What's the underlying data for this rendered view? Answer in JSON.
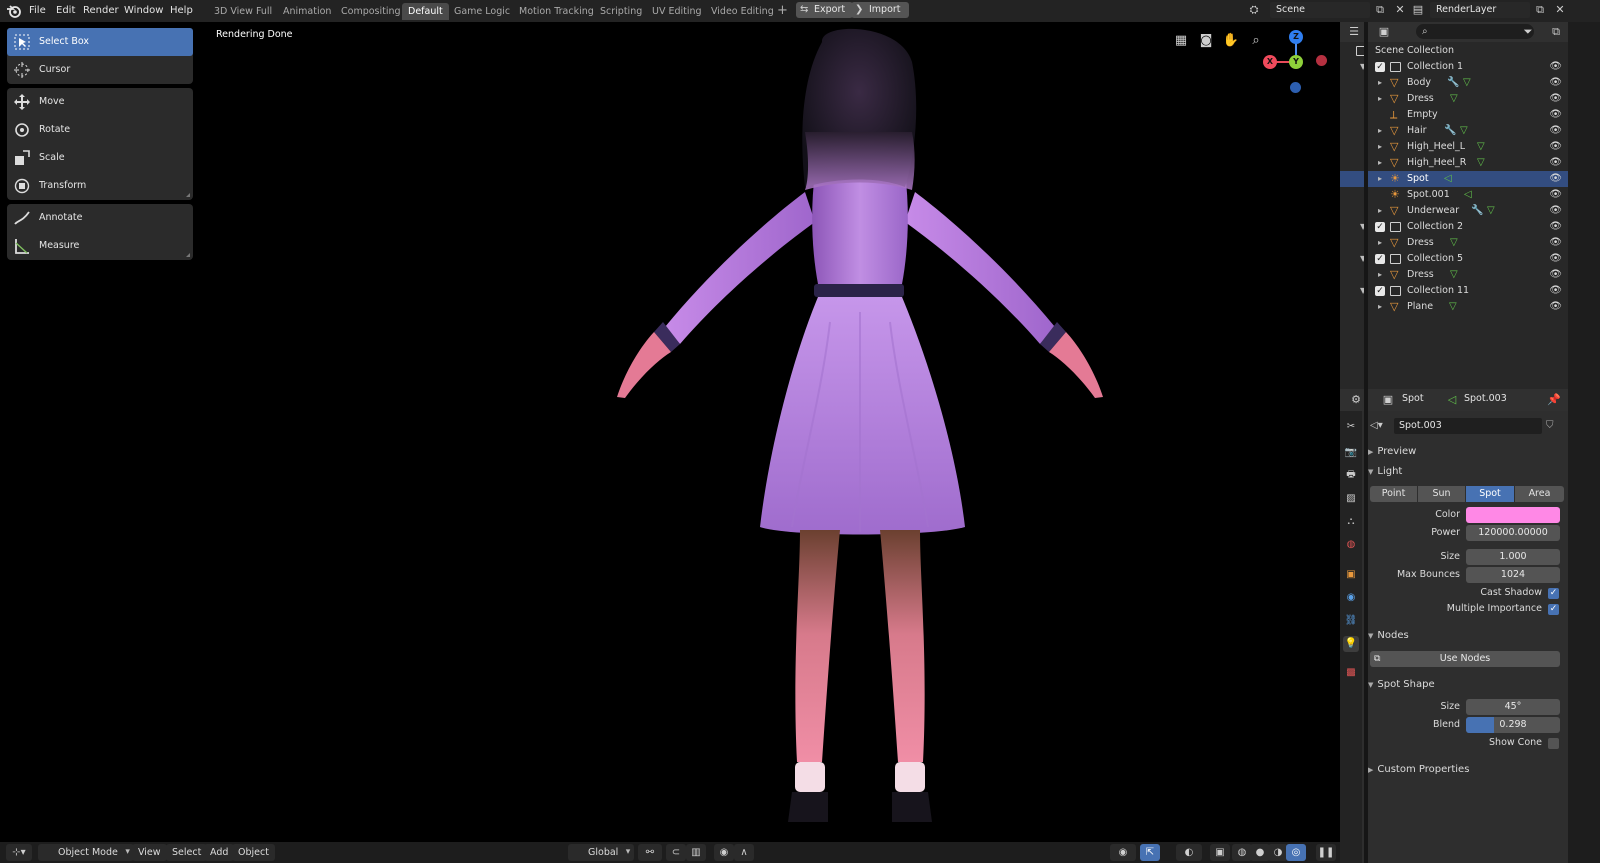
{
  "menu": [
    "File",
    "Edit",
    "Render",
    "Window",
    "Help"
  ],
  "workspaces": [
    "3D View Full",
    "Animation",
    "Compositing",
    "Default",
    "Game Logic",
    "Motion Tracking",
    "Scripting",
    "UV Editing",
    "Video Editing"
  ],
  "active_workspace": "Default",
  "header_buttons": {
    "export": "Export",
    "import": "Import"
  },
  "scene": "Scene",
  "render_layer": "RenderLayer",
  "tools": {
    "select_box": "Select Box",
    "cursor": "Cursor",
    "move": "Move",
    "rotate": "Rotate",
    "scale": "Scale",
    "transform": "Transform",
    "annotate": "Annotate",
    "measure": "Measure"
  },
  "viewport": {
    "status": "Rendering Done",
    "gizmo": {
      "z": "Z",
      "y": "Y",
      "x": "X"
    }
  },
  "bottom_bar": {
    "mode": "Object Mode",
    "view": "View",
    "select": "Select",
    "add": "Add",
    "object": "Object",
    "orientation": "Global"
  },
  "outliner": {
    "root": "Scene Collection",
    "rows": [
      {
        "name": "Collection 1"
      },
      {
        "name": "Body"
      },
      {
        "name": "Dress"
      },
      {
        "name": "Empty"
      },
      {
        "name": "Hair"
      },
      {
        "name": "High_Heel_L"
      },
      {
        "name": "High_Heel_R"
      },
      {
        "name": "Spot"
      },
      {
        "name": "Spot.001"
      },
      {
        "name": "Underwear"
      },
      {
        "name": "Collection 2"
      },
      {
        "name": "Dress"
      },
      {
        "name": "Collection 5"
      },
      {
        "name": "Dress"
      },
      {
        "name": "Collection 11"
      },
      {
        "name": "Plane"
      }
    ]
  },
  "properties": {
    "object": "Spot",
    "data": "Spot.003",
    "datablock": "Spot.003",
    "panels": {
      "preview": "Preview",
      "light": "Light",
      "nodes": "Nodes",
      "spot_shape": "Spot Shape",
      "custom": "Custom Properties"
    },
    "light_types": [
      "Point",
      "Sun",
      "Spot",
      "Area"
    ],
    "active_light_type": "Spot",
    "color_label": "Color",
    "color_value": "#ff88e6",
    "power_label": "Power",
    "power": "120000.00000",
    "size_label": "Size",
    "size": "1.000",
    "max_bounces_label": "Max Bounces",
    "max_bounces": "1024",
    "cast_shadow_label": "Cast Shadow",
    "multiple_importance_label": "Multiple Importance",
    "use_nodes": "Use Nodes",
    "spot_size_label": "Size",
    "spot_size": "45°",
    "blend_label": "Blend",
    "blend": "0.298",
    "blend_fraction": 0.298,
    "show_cone_label": "Show Cone"
  }
}
